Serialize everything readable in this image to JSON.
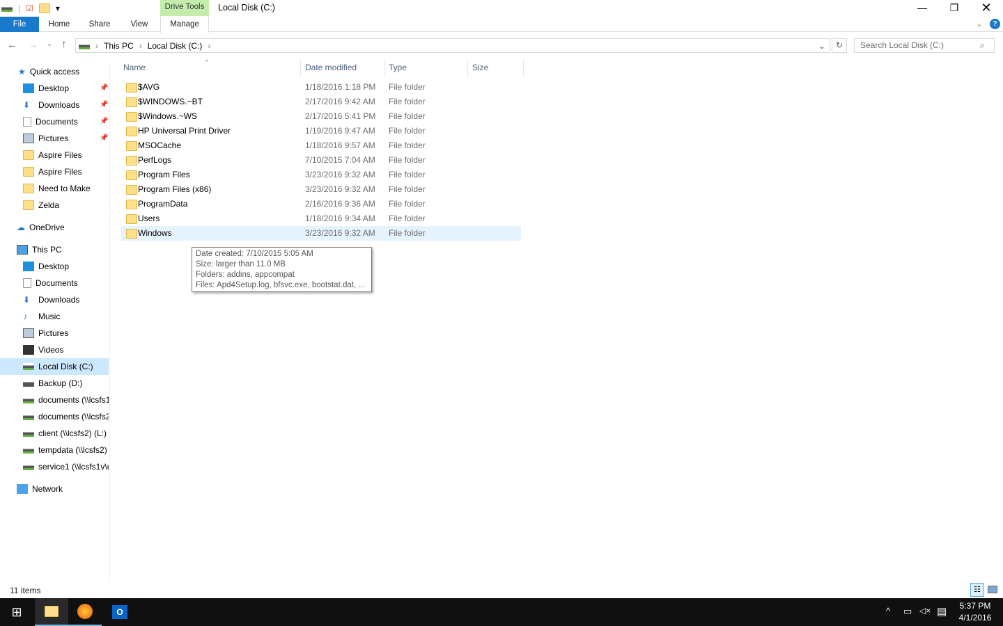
{
  "window": {
    "title": "Local Disk (C:)",
    "context_tab": "Drive Tools"
  },
  "ribbon": {
    "tabs": [
      "File",
      "Home",
      "Share",
      "View",
      "Manage"
    ]
  },
  "address": {
    "crumbs": [
      "This PC",
      "Local Disk (C:)"
    ],
    "search_placeholder": "Search Local Disk (C:)"
  },
  "sidebar": {
    "quick_access": "Quick access",
    "quick": [
      {
        "label": "Desktop",
        "pinned": true
      },
      {
        "label": "Downloads",
        "pinned": true
      },
      {
        "label": "Documents",
        "pinned": true
      },
      {
        "label": "Pictures",
        "pinned": true
      },
      {
        "label": "Aspire Files"
      },
      {
        "label": "Aspire Files"
      },
      {
        "label": "Need to Make"
      },
      {
        "label": "Zelda"
      }
    ],
    "onedrive": "OneDrive",
    "thispc": "This PC",
    "pc": [
      "Desktop",
      "Documents",
      "Downloads",
      "Music",
      "Pictures",
      "Videos",
      "Local Disk (C:)",
      "Backup (D:)",
      "documents (\\\\lcsfs1",
      "documents (\\\\lcsfs2",
      "client (\\\\lcsfs2) (L:)",
      "tempdata (\\\\lcsfs2)",
      "service1 (\\\\lcsfs1v\\u"
    ],
    "network": "Network"
  },
  "columns": [
    "Name",
    "Date modified",
    "Type",
    "Size"
  ],
  "files": [
    {
      "name": "$AVG",
      "date": "1/18/2016 1:18 PM",
      "type": "File folder"
    },
    {
      "name": "$WINDOWS.~BT",
      "date": "2/17/2016 9:42 AM",
      "type": "File folder"
    },
    {
      "name": "$Windows.~WS",
      "date": "2/17/2016 5:41 PM",
      "type": "File folder"
    },
    {
      "name": "HP Universal Print Driver",
      "date": "1/19/2016 9:47 AM",
      "type": "File folder"
    },
    {
      "name": "MSOCache",
      "date": "1/18/2016 9:57 AM",
      "type": "File folder"
    },
    {
      "name": "PerfLogs",
      "date": "7/10/2015 7:04 AM",
      "type": "File folder"
    },
    {
      "name": "Program Files",
      "date": "3/23/2016 9:32 AM",
      "type": "File folder"
    },
    {
      "name": "Program Files (x86)",
      "date": "3/23/2016 9:32 AM",
      "type": "File folder"
    },
    {
      "name": "ProgramData",
      "date": "2/16/2016 9:36 AM",
      "type": "File folder"
    },
    {
      "name": "Users",
      "date": "1/18/2016 9:34 AM",
      "type": "File folder"
    },
    {
      "name": "Windows",
      "date": "3/23/2016 9:32 AM",
      "type": "File folder"
    }
  ],
  "tooltip": [
    "Date created: 7/10/2015 5:05 AM",
    "Size: larger than 11.0 MB",
    "Folders: addins, appcompat",
    "Files: Apd4Setup.log, bfsvc.exe, bootstat.dat, ..."
  ],
  "status": "11 items",
  "clock": {
    "time": "5:37 PM",
    "date": "4/1/2016"
  },
  "colors": {
    "accent": "#1979ca",
    "drive_tools": "#c4ecab",
    "selection": "#cce8ff"
  }
}
